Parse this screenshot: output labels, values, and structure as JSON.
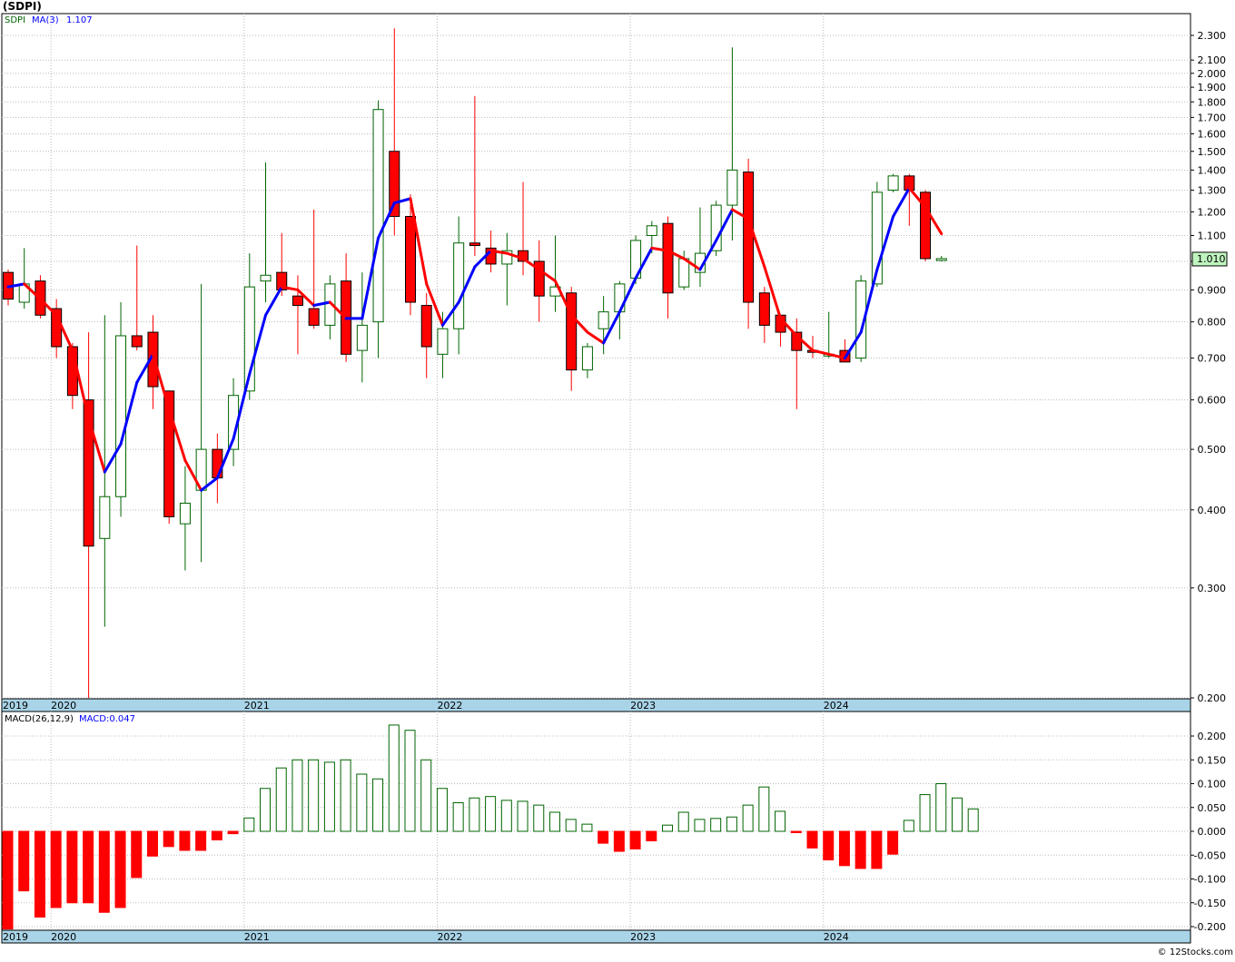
{
  "header": {
    "symbol_title": "(SDPI)",
    "price_legend_symbol": "SDPI",
    "price_legend_ma": "MA(3)",
    "price_legend_ma_value": "1.107",
    "macd_legend_label": "MACD(26,12,9)",
    "macd_legend_value": "MACD:0.047",
    "last_price_tag": "1.010",
    "footer_credit": "© 12Stocks.com"
  },
  "colors": {
    "up_candle": "#006400",
    "down_candle": "#ff0000",
    "ma_rising": "#0000ff",
    "ma_falling": "#ff0000",
    "axis_band": "#a9d4e8",
    "grid": "#bbbbbb",
    "last_price_tag": "#bff5bf"
  },
  "chart_data": [
    {
      "type": "candlestick",
      "name": "price",
      "scale": "log",
      "ylim": [
        0.2,
        2.4
      ],
      "grid": true,
      "y_ticks": [
        0.2,
        0.3,
        0.4,
        0.5,
        0.6,
        0.7,
        0.8,
        0.9,
        1.0,
        1.1,
        1.2,
        1.3,
        1.4,
        1.5,
        1.6,
        1.7,
        1.8,
        1.9,
        2.0,
        2.1,
        2.3
      ],
      "y_tick_labels": [
        "0.200",
        "0.300",
        "0.400",
        "0.500",
        "0.600",
        "0.700",
        "0.800",
        "0.900",
        "1.000",
        "1.100",
        "1.200",
        "1.300",
        "1.400",
        "1.500",
        "1.600",
        "1.700",
        "1.800",
        "1.900",
        "2.000",
        "2.100",
        "2.300"
      ],
      "x_labels": [
        {
          "label": "2019",
          "month": "2019-10"
        },
        {
          "label": "2020",
          "month": "2020-01"
        },
        {
          "label": "2021",
          "month": "2021-01"
        },
        {
          "label": "2022",
          "month": "2022-01"
        },
        {
          "label": "2023",
          "month": "2023-01"
        },
        {
          "label": "2024",
          "month": "2024-01"
        }
      ],
      "candles": [
        {
          "month": "2019-10",
          "open": 0.96,
          "high": 0.97,
          "low": 0.85,
          "close": 0.87
        },
        {
          "month": "2019-11",
          "open": 0.86,
          "high": 1.05,
          "low": 0.84,
          "close": 0.92
        },
        {
          "month": "2019-12",
          "open": 0.93,
          "high": 0.95,
          "low": 0.81,
          "close": 0.82
        },
        {
          "month": "2020-01",
          "open": 0.84,
          "high": 0.87,
          "low": 0.7,
          "close": 0.73
        },
        {
          "month": "2020-02",
          "open": 0.73,
          "high": 0.74,
          "low": 0.58,
          "close": 0.61
        },
        {
          "month": "2020-03",
          "open": 0.6,
          "high": 0.77,
          "low": 0.2,
          "close": 0.35
        },
        {
          "month": "2020-04",
          "open": 0.36,
          "high": 0.82,
          "low": 0.26,
          "close": 0.42
        },
        {
          "month": "2020-05",
          "open": 0.42,
          "high": 0.86,
          "low": 0.39,
          "close": 0.76
        },
        {
          "month": "2020-06",
          "open": 0.76,
          "high": 1.06,
          "low": 0.72,
          "close": 0.73
        },
        {
          "month": "2020-07",
          "open": 0.77,
          "high": 0.82,
          "low": 0.58,
          "close": 0.63
        },
        {
          "month": "2020-08",
          "open": 0.62,
          "high": 0.62,
          "low": 0.38,
          "close": 0.39
        },
        {
          "month": "2020-09",
          "open": 0.38,
          "high": 0.47,
          "low": 0.32,
          "close": 0.41
        },
        {
          "month": "2020-10",
          "open": 0.43,
          "high": 0.92,
          "low": 0.33,
          "close": 0.5
        },
        {
          "month": "2020-11",
          "open": 0.5,
          "high": 0.53,
          "low": 0.41,
          "close": 0.45
        },
        {
          "month": "2020-12",
          "open": 0.5,
          "high": 0.65,
          "low": 0.47,
          "close": 0.61
        },
        {
          "month": "2021-01",
          "open": 0.62,
          "high": 1.03,
          "low": 0.6,
          "close": 0.91
        },
        {
          "month": "2021-02",
          "open": 0.93,
          "high": 1.44,
          "low": 0.86,
          "close": 0.95
        },
        {
          "month": "2021-03",
          "open": 0.96,
          "high": 1.11,
          "low": 0.88,
          "close": 0.9
        },
        {
          "month": "2021-04",
          "open": 0.88,
          "high": 0.95,
          "low": 0.71,
          "close": 0.85
        },
        {
          "month": "2021-05",
          "open": 0.84,
          "high": 1.21,
          "low": 0.78,
          "close": 0.79
        },
        {
          "month": "2021-06",
          "open": 0.79,
          "high": 0.95,
          "low": 0.75,
          "close": 0.92
        },
        {
          "month": "2021-07",
          "open": 0.93,
          "high": 1.03,
          "low": 0.69,
          "close": 0.71
        },
        {
          "month": "2021-08",
          "open": 0.72,
          "high": 0.96,
          "low": 0.64,
          "close": 0.79
        },
        {
          "month": "2021-09",
          "open": 0.8,
          "high": 1.81,
          "low": 0.7,
          "close": 1.75
        },
        {
          "month": "2021-10",
          "open": 1.5,
          "high": 2.36,
          "low": 1.1,
          "close": 1.18
        },
        {
          "month": "2021-11",
          "open": 1.18,
          "high": 1.28,
          "low": 0.82,
          "close": 0.86
        },
        {
          "month": "2021-12",
          "open": 0.85,
          "high": 0.89,
          "low": 0.65,
          "close": 0.73
        },
        {
          "month": "2022-01",
          "open": 0.71,
          "high": 0.83,
          "low": 0.65,
          "close": 0.78
        },
        {
          "month": "2022-02",
          "open": 0.78,
          "high": 1.18,
          "low": 0.71,
          "close": 1.07
        },
        {
          "month": "2022-03",
          "open": 1.07,
          "high": 1.84,
          "low": 1.02,
          "close": 1.06
        },
        {
          "month": "2022-04",
          "open": 1.05,
          "high": 1.12,
          "low": 0.96,
          "close": 0.99
        },
        {
          "month": "2022-05",
          "open": 0.99,
          "high": 1.11,
          "low": 0.85,
          "close": 1.04
        },
        {
          "month": "2022-06",
          "open": 1.04,
          "high": 1.34,
          "low": 0.95,
          "close": 1.0
        },
        {
          "month": "2022-07",
          "open": 1.0,
          "high": 1.08,
          "low": 0.8,
          "close": 0.88
        },
        {
          "month": "2022-08",
          "open": 0.88,
          "high": 1.1,
          "low": 0.83,
          "close": 0.91
        },
        {
          "month": "2022-09",
          "open": 0.89,
          "high": 0.91,
          "low": 0.62,
          "close": 0.67
        },
        {
          "month": "2022-10",
          "open": 0.67,
          "high": 0.74,
          "low": 0.65,
          "close": 0.73
        },
        {
          "month": "2022-11",
          "open": 0.78,
          "high": 0.88,
          "low": 0.71,
          "close": 0.83
        },
        {
          "month": "2022-12",
          "open": 0.83,
          "high": 0.93,
          "low": 0.75,
          "close": 0.92
        },
        {
          "month": "2023-01",
          "open": 0.94,
          "high": 1.1,
          "low": 0.92,
          "close": 1.08
        },
        {
          "month": "2023-02",
          "open": 1.1,
          "high": 1.16,
          "low": 1.03,
          "close": 1.14
        },
        {
          "month": "2023-03",
          "open": 1.15,
          "high": 1.18,
          "low": 0.81,
          "close": 0.89
        },
        {
          "month": "2023-04",
          "open": 0.91,
          "high": 1.04,
          "low": 0.9,
          "close": 1.01
        },
        {
          "month": "2023-05",
          "open": 0.96,
          "high": 1.22,
          "low": 0.91,
          "close": 1.03
        },
        {
          "month": "2023-06",
          "open": 1.04,
          "high": 1.25,
          "low": 1.02,
          "close": 1.23
        },
        {
          "month": "2023-07",
          "open": 1.23,
          "high": 2.2,
          "low": 1.08,
          "close": 1.4
        },
        {
          "month": "2023-08",
          "open": 1.39,
          "high": 1.46,
          "low": 0.78,
          "close": 0.86
        },
        {
          "month": "2023-09",
          "open": 0.89,
          "high": 0.91,
          "low": 0.74,
          "close": 0.79
        },
        {
          "month": "2023-10",
          "open": 0.82,
          "high": 0.82,
          "low": 0.73,
          "close": 0.77
        },
        {
          "month": "2023-11",
          "open": 0.77,
          "high": 0.81,
          "low": 0.58,
          "close": 0.72
        },
        {
          "month": "2023-12",
          "open": 0.72,
          "high": 0.76,
          "low": 0.7,
          "close": 0.715
        },
        {
          "month": "2024-01",
          "open": 0.71,
          "high": 0.83,
          "low": 0.7,
          "close": 0.71
        },
        {
          "month": "2024-02",
          "open": 0.72,
          "high": 0.75,
          "low": 0.69,
          "close": 0.69
        },
        {
          "month": "2024-03",
          "open": 0.7,
          "high": 0.95,
          "low": 0.69,
          "close": 0.93
        },
        {
          "month": "2024-04",
          "open": 0.92,
          "high": 1.34,
          "low": 0.91,
          "close": 1.29
        },
        {
          "month": "2024-05",
          "open": 1.3,
          "high": 1.38,
          "low": 1.29,
          "close": 1.37
        },
        {
          "month": "2024-06",
          "open": 1.37,
          "high": 1.38,
          "low": 1.14,
          "close": 1.3
        },
        {
          "month": "2024-07",
          "open": 1.29,
          "high": 1.3,
          "low": 1.0,
          "close": 1.01
        },
        {
          "month": "2024-08",
          "open": 1.01,
          "high": 1.02,
          "low": 1.0,
          "close": 1.01
        }
      ],
      "ma3": [
        0.91,
        0.92,
        0.87,
        0.82,
        0.72,
        0.56,
        0.46,
        0.51,
        0.64,
        0.71,
        0.58,
        0.48,
        0.43,
        0.45,
        0.52,
        0.66,
        0.82,
        0.91,
        0.9,
        0.85,
        0.86,
        0.81,
        0.81,
        1.09,
        1.24,
        1.26,
        0.92,
        0.79,
        0.86,
        0.98,
        1.04,
        1.03,
        1.01,
        0.97,
        0.93,
        0.82,
        0.77,
        0.74,
        0.83,
        0.94,
        1.05,
        1.04,
        1.01,
        0.97,
        1.08,
        1.21,
        1.17,
        0.98,
        0.81,
        0.76,
        0.72,
        0.71,
        0.7,
        0.77,
        0.97,
        1.18,
        1.31,
        1.22,
        1.107
      ]
    },
    {
      "type": "bar",
      "name": "MACD",
      "ylim": [
        -0.21,
        0.24
      ],
      "grid": true,
      "y_ticks": [
        -0.2,
        -0.15,
        -0.1,
        -0.05,
        0.0,
        0.05,
        0.1,
        0.15,
        0.2
      ],
      "y_tick_labels": [
        "-0.200",
        "-0.150",
        "-0.100",
        "-0.050",
        "0.000",
        "0.050",
        "0.100",
        "0.150",
        "0.200"
      ],
      "values": [
        -0.205,
        -0.125,
        -0.18,
        -0.16,
        -0.15,
        -0.15,
        -0.17,
        -0.16,
        -0.097,
        -0.052,
        -0.032,
        -0.04,
        -0.04,
        -0.018,
        -0.005,
        0.028,
        0.09,
        0.133,
        0.15,
        0.15,
        0.145,
        0.15,
        0.12,
        0.11,
        0.223,
        0.212,
        0.15,
        0.09,
        0.06,
        0.07,
        0.073,
        0.065,
        0.063,
        0.055,
        0.04,
        0.025,
        0.015,
        -0.025,
        -0.042,
        -0.037,
        -0.02,
        0.013,
        0.04,
        0.025,
        0.027,
        0.03,
        0.055,
        0.093,
        0.042,
        -0.002,
        -0.035,
        -0.06,
        -0.072,
        -0.078,
        -0.078,
        -0.048,
        0.023,
        0.077,
        0.1,
        0.07,
        0.047
      ]
    }
  ]
}
